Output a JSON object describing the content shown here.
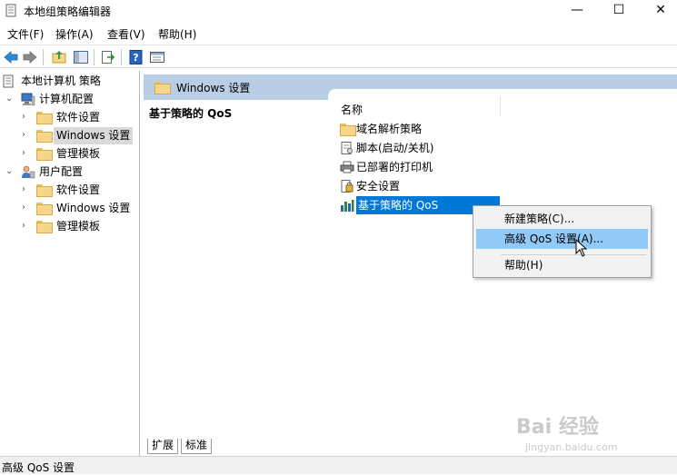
{
  "window": {
    "title": "本地组策略编辑器",
    "min_glyph": "—",
    "max_glyph": "☐",
    "close_glyph": "✕"
  },
  "menu": [
    "文件(F)",
    "操作(A)",
    "查看(V)",
    "帮助(H)"
  ],
  "tree": {
    "root": "本地计算机 策略",
    "computer_config": "计算机配置",
    "computer_children": [
      "软件设置",
      "Windows 设置",
      "管理模板"
    ],
    "user_config": "用户配置",
    "user_children": [
      "软件设置",
      "Windows 设置",
      "管理模板"
    ],
    "selected": "Windows 设置"
  },
  "right": {
    "header": "Windows 设置",
    "desc_title": "基于策略的 QoS",
    "column_name": "名称",
    "items": [
      "域名解析策略",
      "脚本(启动/关机)",
      "已部署的打印机",
      "安全设置",
      "基于策略的 QoS"
    ],
    "selected_item": "基于策略的 QoS",
    "tabs": [
      "扩展",
      "标准"
    ]
  },
  "context_menu": {
    "items": [
      "新建策略(C)...",
      "高级 QoS 设置(A)...",
      "帮助(H)"
    ],
    "highlighted": "高级 QoS 设置(A)..."
  },
  "status": "高级 QoS 设置",
  "watermark": {
    "main": "Bai 经验",
    "sub": "jingyan.baidu.com"
  },
  "colors": {
    "header_band": "#b9cde5",
    "selection": "#0078d7",
    "menu_hover": "#91c9f7",
    "tree_selected": "#d9d9d9"
  }
}
